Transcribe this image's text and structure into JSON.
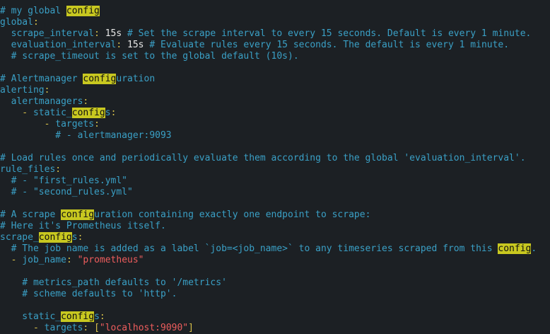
{
  "editor": {
    "lines": [
      [
        {
          "t": "# my global ",
          "c": "c"
        },
        {
          "t": "config",
          "c": "hl"
        }
      ],
      [
        {
          "t": "global",
          "c": "k"
        },
        {
          "t": ":",
          "c": "p"
        }
      ],
      [
        {
          "t": "  scrape_interval",
          "c": "k"
        },
        {
          "t": ": ",
          "c": "p"
        },
        {
          "t": "15s",
          "c": "v"
        },
        {
          "t": " # Set the scrape interval to every 15 seconds. Default is every 1 minute.",
          "c": "c"
        }
      ],
      [
        {
          "t": "  evaluation_interval",
          "c": "k"
        },
        {
          "t": ": ",
          "c": "p"
        },
        {
          "t": "15s",
          "c": "v"
        },
        {
          "t": " # Evaluate rules every 15 seconds. The default is every 1 minute.",
          "c": "c"
        }
      ],
      [
        {
          "t": "  # scrape_timeout is set to the global default (10s).",
          "c": "c"
        }
      ],
      [],
      [
        {
          "t": "# Alertmanager ",
          "c": "c"
        },
        {
          "t": "config",
          "c": "hl"
        },
        {
          "t": "uration",
          "c": "c"
        }
      ],
      [
        {
          "t": "alerting",
          "c": "k"
        },
        {
          "t": ":",
          "c": "p"
        }
      ],
      [
        {
          "t": "  alertmanagers",
          "c": "k"
        },
        {
          "t": ":",
          "c": "p"
        }
      ],
      [
        {
          "t": "    - ",
          "c": "p"
        },
        {
          "t": "static_",
          "c": "k"
        },
        {
          "t": "config",
          "c": "hl"
        },
        {
          "t": "s",
          "c": "k"
        },
        {
          "t": ":",
          "c": "p"
        }
      ],
      [
        {
          "t": "        - ",
          "c": "p"
        },
        {
          "t": "targets",
          "c": "k"
        },
        {
          "t": ":",
          "c": "p"
        }
      ],
      [
        {
          "t": "          # - alertmanager:9093",
          "c": "c"
        }
      ],
      [],
      [
        {
          "t": "# Load rules once and periodically evaluate them according to the global 'evaluation_interval'.",
          "c": "c"
        }
      ],
      [
        {
          "t": "rule_files",
          "c": "k"
        },
        {
          "t": ":",
          "c": "p"
        }
      ],
      [
        {
          "t": "  # - \"first_rules.yml\"",
          "c": "c"
        }
      ],
      [
        {
          "t": "  # - \"second_rules.yml\"",
          "c": "c"
        }
      ],
      [],
      [
        {
          "t": "# A scrape ",
          "c": "c"
        },
        {
          "t": "config",
          "c": "hl"
        },
        {
          "t": "uration containing exactly one endpoint to scrape:",
          "c": "c"
        }
      ],
      [
        {
          "t": "# Here it's Prometheus itself.",
          "c": "c"
        }
      ],
      [
        {
          "t": "scrape_",
          "c": "k"
        },
        {
          "t": "config",
          "c": "hl"
        },
        {
          "t": "s",
          "c": "k"
        },
        {
          "t": ":",
          "c": "p"
        }
      ],
      [
        {
          "t": "  # The job name is added as a label `job=<job_name>` to any timeseries scraped from this ",
          "c": "c"
        },
        {
          "t": "config",
          "c": "hl"
        },
        {
          "t": ".",
          "c": "c"
        }
      ],
      [
        {
          "t": "  - ",
          "c": "p"
        },
        {
          "t": "job_name",
          "c": "k"
        },
        {
          "t": ": ",
          "c": "p"
        },
        {
          "t": "\"prometheus\"",
          "c": "s"
        }
      ],
      [],
      [
        {
          "t": "    # metrics_path defaults to '/metrics'",
          "c": "c"
        }
      ],
      [
        {
          "t": "    # scheme defaults to 'http'.",
          "c": "c"
        }
      ],
      [],
      [
        {
          "t": "    static_",
          "c": "k"
        },
        {
          "t": "config",
          "c": "hl"
        },
        {
          "t": "s",
          "c": "k"
        },
        {
          "t": ":",
          "c": "p"
        }
      ],
      [
        {
          "t": "      - ",
          "c": "p"
        },
        {
          "t": "targets",
          "c": "k"
        },
        {
          "t": ": [",
          "c": "p"
        },
        {
          "t": "\"localhost:9090\"",
          "c": "s"
        },
        {
          "t": "]",
          "c": "p"
        }
      ]
    ]
  }
}
